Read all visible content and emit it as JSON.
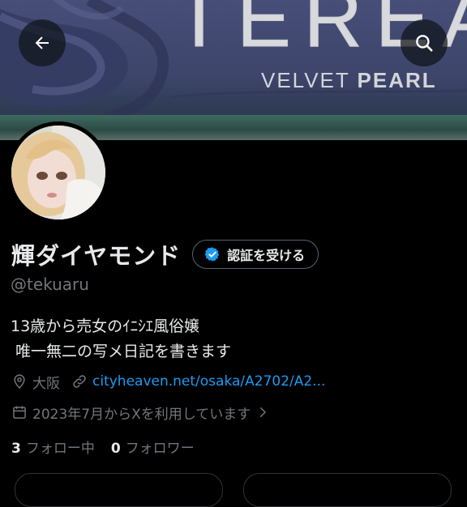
{
  "header": {
    "banner_brand": "TEREA",
    "banner_sub_light": "VELVET",
    "banner_sub_bold": "PEARL",
    "back_icon": "arrow-left-icon",
    "search_icon": "search-icon"
  },
  "profile": {
    "display_name": "輝ダイヤモンド",
    "verify_label": "認証を受ける",
    "handle": "@tekuaru",
    "bio_line1": "13歳から売女のｲﾆｼｴ風俗嬢",
    "bio_line2": " 唯一無二の写メ日記を書きます",
    "location": "大阪",
    "link": "cityheaven.net/osaka/A2702/A2...",
    "joined": "2023年7月からXを利用しています",
    "following_count": "3",
    "following_label": "フォロー中",
    "followers_count": "0",
    "followers_label": "フォロワー"
  },
  "colors": {
    "background": "#000000",
    "text": "#e7e9ea",
    "muted": "#71767b",
    "link": "#1d9bf0",
    "verify_badge": "#1d9bf0"
  }
}
